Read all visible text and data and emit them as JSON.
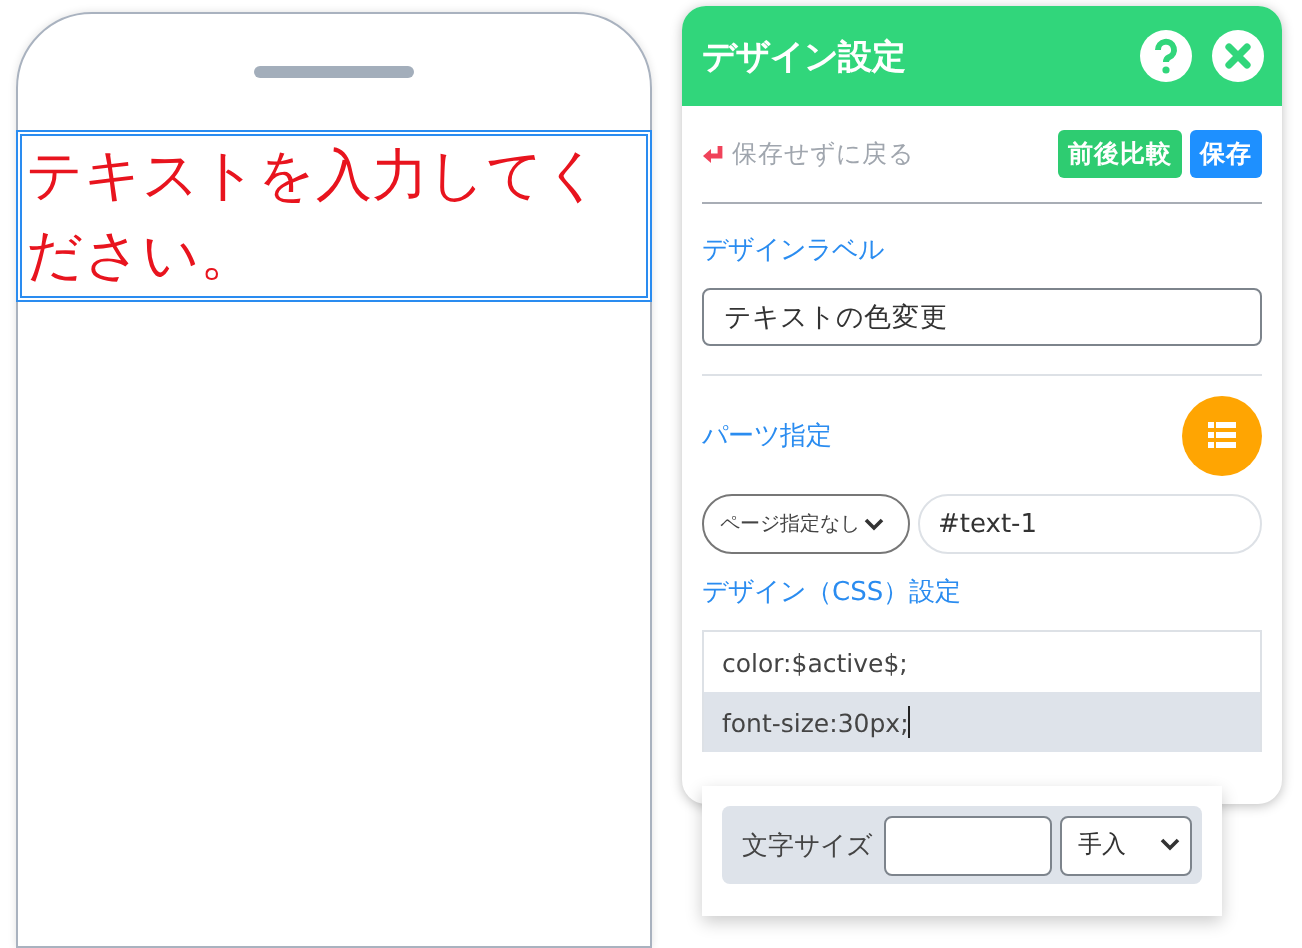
{
  "preview": {
    "text": "テキストを入力してください。",
    "selected": true
  },
  "panel": {
    "title": "デザイン設定",
    "back_link": "保存せずに戻る",
    "buttons": [
      {
        "label": "前後比較",
        "kind": "compare"
      },
      {
        "label": "保存",
        "kind": "save"
      }
    ],
    "label_section": {
      "title": "デザインラベル",
      "value": "テキストの色変更"
    },
    "parts_section": {
      "title": "パーツ指定",
      "page_select": "ページ指定なし",
      "selector": "#text-1"
    },
    "css_section": {
      "title": "デザイン（CSS）設定",
      "lines": [
        {
          "text": "color:$active$;",
          "selected": false
        },
        {
          "text": "font-size:30px;",
          "selected": true
        }
      ]
    }
  },
  "popup": {
    "label": "文字サイズ",
    "unit_select": "手入"
  }
}
